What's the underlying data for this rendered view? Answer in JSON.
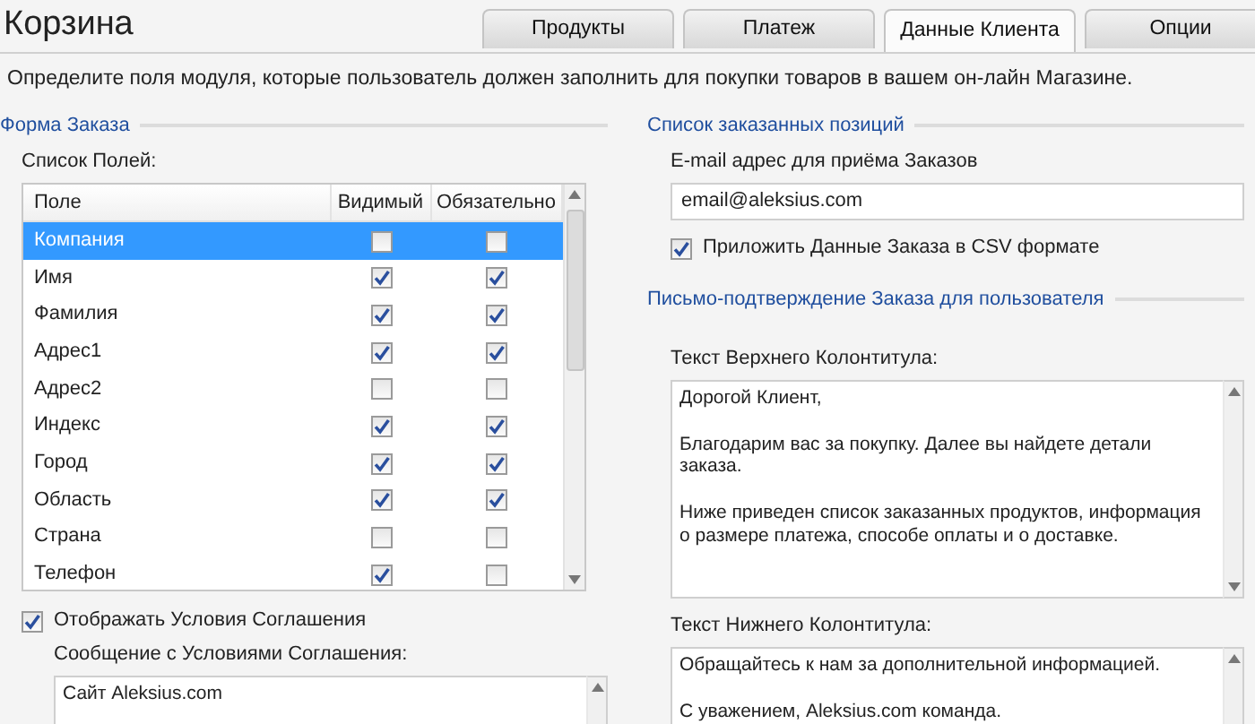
{
  "title": "Корзина",
  "tabs": [
    {
      "label": "Продукты",
      "selected": false
    },
    {
      "label": "Платеж",
      "selected": false
    },
    {
      "label": "Данные Клиента",
      "selected": true
    },
    {
      "label": "Опции",
      "selected": false
    }
  ],
  "description": "Определите поля модуля, которые пользователь должен заполнить для покупки товаров в вашем он-лайн Магазине.",
  "order_form": {
    "heading": "Форма Заказа",
    "fields_label": "Список Полей:",
    "table": {
      "columns": [
        "Поле",
        "Видимый",
        "Обязательно"
      ],
      "rows": [
        {
          "field": "Компания",
          "visible": false,
          "required": false,
          "selected": true
        },
        {
          "field": "Имя",
          "visible": true,
          "required": true,
          "selected": false
        },
        {
          "field": "Фамилия",
          "visible": true,
          "required": true,
          "selected": false
        },
        {
          "field": "Адрес1",
          "visible": true,
          "required": true,
          "selected": false
        },
        {
          "field": "Адрес2",
          "visible": false,
          "required": false,
          "selected": false
        },
        {
          "field": "Индекс",
          "visible": true,
          "required": true,
          "selected": false
        },
        {
          "field": "Город",
          "visible": true,
          "required": true,
          "selected": false
        },
        {
          "field": "Область",
          "visible": true,
          "required": true,
          "selected": false
        },
        {
          "field": "Страна",
          "visible": false,
          "required": false,
          "selected": false
        },
        {
          "field": "Телефон",
          "visible": true,
          "required": false,
          "selected": false
        }
      ]
    },
    "show_terms": {
      "label": "Отображать Условия Соглашения",
      "checked": true
    },
    "terms_message": {
      "label": "Сообщение с Условиями Соглашения:",
      "value": "Сайт Aleksius.com"
    }
  },
  "ordered_items": {
    "heading": "Список заказанных позиций",
    "email_label": "E-mail адрес для приёма Заказов",
    "email_value": "email@aleksius.com",
    "attach_csv": {
      "label": "Приложить Данные Заказа в CSV формате",
      "checked": true
    }
  },
  "confirmation": {
    "heading": "Письмо-подтверждение Заказа для пользователя",
    "header_label": "Текст Верхнего Колонтитула:",
    "header_text": "Дорогой Клиент,\n\nБлагодарим вас за покупку. Далее вы найдете детали\nзаказа.\n\nНиже приведен список заказанных продуктов, информация\nо размере платежа, способе оплаты и о доставке.",
    "footer_label": "Текст Нижнего Колонтитула:",
    "footer_text": "Обращайтесь к нам за дополнительной информацией.\n\nС уважением, Aleksius.com команда."
  }
}
